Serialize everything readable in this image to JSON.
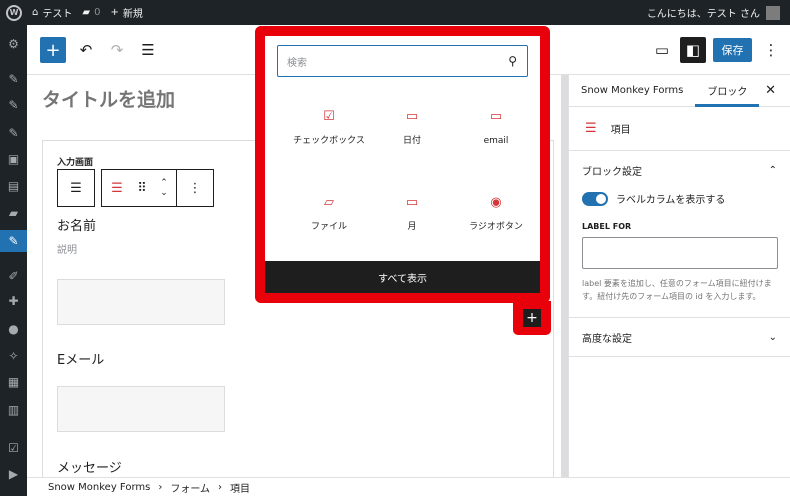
{
  "adminbar": {
    "site_name": "テスト",
    "comments_count": "0",
    "new_label": "新規",
    "greeting": "こんにちは、テスト さん"
  },
  "sidebar": {
    "items": [
      "dashboard",
      "posts",
      "pages-pin",
      "pin",
      "media",
      "pages",
      "comments",
      "snow-monkey-forms",
      "appearance",
      "plugins",
      "users",
      "tools",
      "settings",
      "grid",
      "check",
      "play"
    ]
  },
  "toolbar": {
    "add_label": "+",
    "save_label": "保存"
  },
  "editor": {
    "post_title_placeholder": "タイトルを追加",
    "form_section_label": "入力画面",
    "fields": [
      {
        "label": "お名前",
        "description": "説明"
      },
      {
        "label": "Eメール",
        "description": ""
      },
      {
        "label": "メッセージ",
        "description": ""
      }
    ]
  },
  "inserter": {
    "search_placeholder": "検索",
    "items": [
      {
        "label": "チェックボックス",
        "icon": "checkbox-icon"
      },
      {
        "label": "日付",
        "icon": "date-icon"
      },
      {
        "label": "email",
        "icon": "email-icon"
      },
      {
        "label": "ファイル",
        "icon": "folder-icon"
      },
      {
        "label": "月",
        "icon": "month-icon"
      },
      {
        "label": "ラジオボタン",
        "icon": "radio-icon"
      }
    ],
    "show_all_label": "すべて表示"
  },
  "settings": {
    "tabs": [
      "Snow Monkey Forms",
      "ブロック"
    ],
    "active_tab": "ブロック",
    "block_name": "項目",
    "block_settings_title": "ブロック設定",
    "toggle_label": "ラベルカラムを表示する",
    "toggle_on": true,
    "label_for_title": "LABEL FOR",
    "label_for_value": "",
    "help_text": "label 要素を追加し、任意のフォーム項目に紐付けます。紐付け先のフォーム項目の id を入力します。",
    "advanced_title": "高度な設定"
  },
  "breadcrumb": [
    "Snow Monkey Forms",
    "フォーム",
    "項目"
  ],
  "colors": {
    "accent": "#2271b1",
    "highlight": "#e8000b",
    "icon_red": "#d63638",
    "admin_dark": "#1d2327"
  }
}
